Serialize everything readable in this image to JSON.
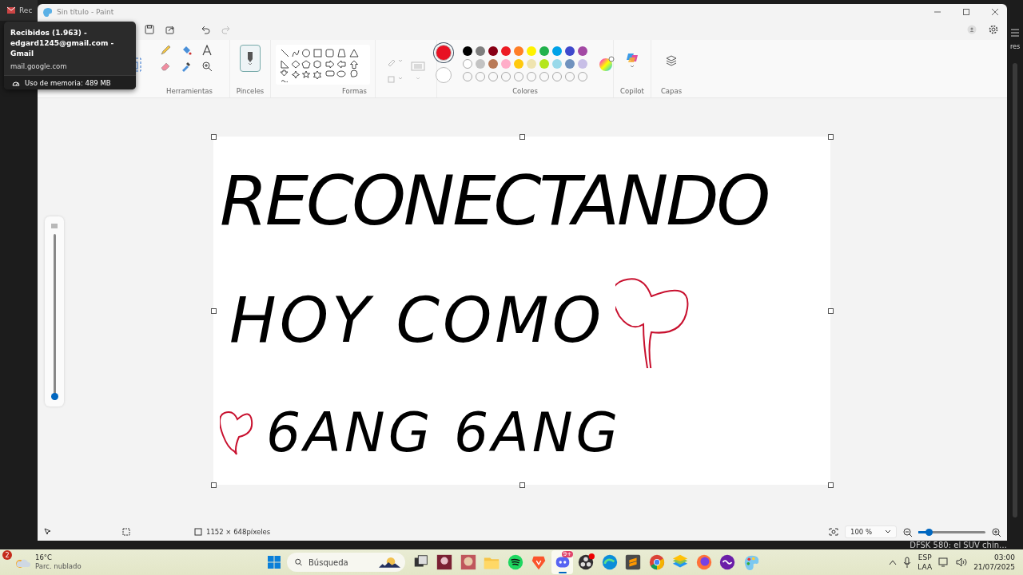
{
  "background_tab": {
    "label": "Rec"
  },
  "tooltip": {
    "title": "Recibidos (1.963) - edgard1245@gmail.com - Gmail",
    "url": "mail.google.com",
    "memory": "Uso de memoria: 489 MB"
  },
  "window": {
    "title": "Sin título - Paint"
  },
  "ribbon": {
    "tools_label": "Herramientas",
    "brushes_label": "Pinceles",
    "shapes_label": "Formas",
    "colors_label": "Colores",
    "copilot_label": "Copilot",
    "layers_label": "Capas"
  },
  "colors": {
    "current": [
      {
        "color": "#e81123",
        "selected": true
      },
      {
        "color": "#ffffff",
        "selected": false
      }
    ],
    "palette": [
      {
        "color": "#000000"
      },
      {
        "color": "#7f7f7f"
      },
      {
        "color": "#880015"
      },
      {
        "color": "#ed1c24"
      },
      {
        "color": "#ff7f27"
      },
      {
        "color": "#fff200"
      },
      {
        "color": "#22b14c"
      },
      {
        "color": "#00a2e8"
      },
      {
        "color": "#3f48cc"
      },
      {
        "color": "#a349a4"
      },
      {
        "color": "#ffffff"
      },
      {
        "color": "#c3c3c3"
      },
      {
        "color": "#b97a57"
      },
      {
        "color": "#ffaec9"
      },
      {
        "color": "#ffc90e"
      },
      {
        "color": "#efe4b0"
      },
      {
        "color": "#b5e61d"
      },
      {
        "color": "#99d9ea"
      },
      {
        "color": "#7092be"
      },
      {
        "color": "#c8bfe7"
      }
    ]
  },
  "canvas": {
    "lines": [
      {
        "parts": [
          {
            "kind": "text",
            "text": "RECONECTANDO"
          }
        ]
      },
      {
        "parts": [
          {
            "kind": "text",
            "text": "HOY COMO"
          },
          {
            "kind": "heart"
          }
        ]
      },
      {
        "parts": [
          {
            "kind": "heart"
          },
          {
            "kind": "text",
            "text": "6ANG 6ANG"
          }
        ]
      }
    ]
  },
  "brush_size": {
    "level": 0.02
  },
  "status_bar": {
    "dimensions": "1152 × 648píxeles",
    "zoom": "100 %",
    "zoom_level": {
      "level": 0.15
    }
  },
  "behind": {
    "headline": "DFSK 580: el SUV chin…",
    "side_text": "res"
  },
  "taskbar": {
    "weather": {
      "badge": "2",
      "temperature": "16°C",
      "condition": "Parc. nublado"
    },
    "search": {
      "placeholder": "Búsqueda"
    },
    "apps": [
      {
        "kind": "taskview",
        "selected": false
      },
      {
        "kind": "photo",
        "selected": false
      },
      {
        "kind": "photo2",
        "selected": false
      },
      {
        "kind": "folder",
        "selected": false
      },
      {
        "kind": "spotify",
        "selected": false
      },
      {
        "kind": "brave",
        "selected": false
      },
      {
        "kind": "discord",
        "selected": true,
        "badge": "9+"
      },
      {
        "kind": "obs",
        "selected": false
      },
      {
        "kind": "edge",
        "selected": false
      },
      {
        "kind": "sublime",
        "selected": false
      },
      {
        "kind": "chrome",
        "selected": false
      },
      {
        "kind": "bluestacks",
        "selected": false
      },
      {
        "kind": "firefox",
        "selected": false
      },
      {
        "kind": "vpn",
        "selected": false
      },
      {
        "kind": "paint",
        "selected": false
      }
    ],
    "language": [
      "ESP",
      "LAA"
    ],
    "time": "03:00",
    "date": "21/07/2025"
  }
}
